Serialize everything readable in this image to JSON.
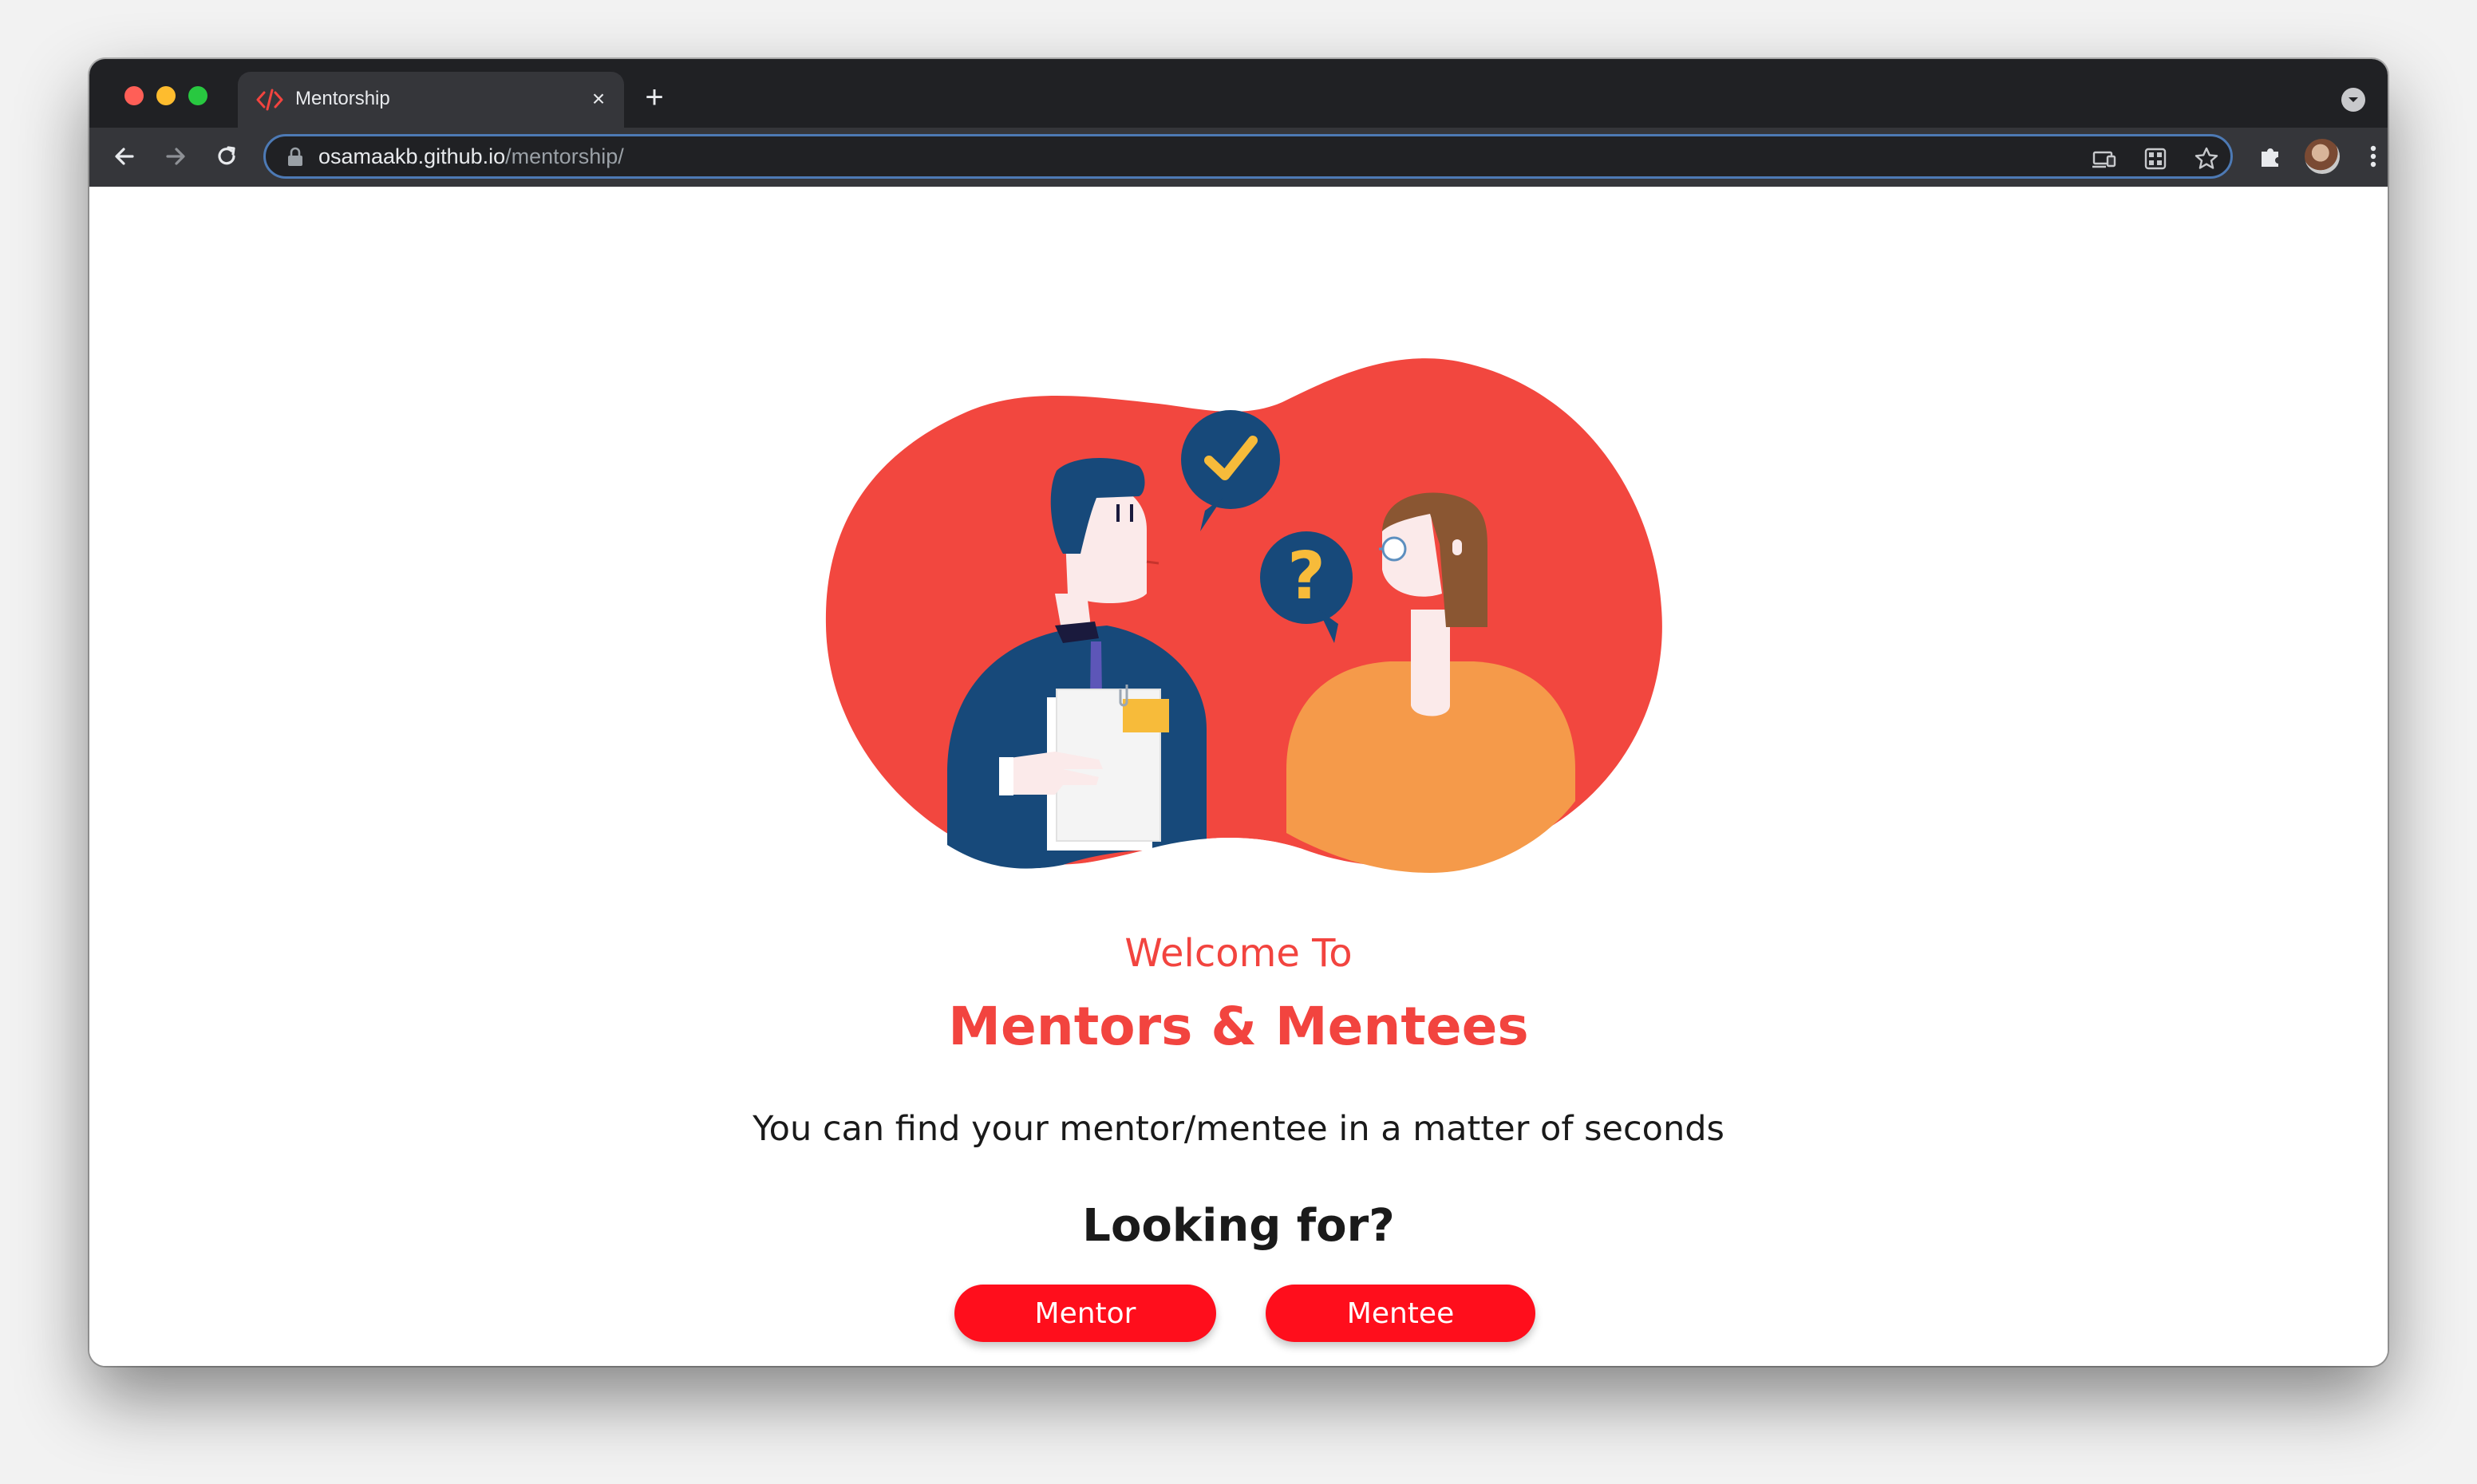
{
  "browser": {
    "tab": {
      "title": "Mentorship",
      "favicon": "code-icon",
      "close": "×"
    },
    "new_tab": "+",
    "url": {
      "host": "osamaakb.github.io",
      "path": "/mentorship/"
    }
  },
  "page": {
    "welcome": "Welcome To",
    "brand": "Mentors & Mentees",
    "tagline": "You can find your mentor/mentee in a matter of seconds",
    "looking_for": "Looking for?",
    "buttons": {
      "mentor": "Mentor",
      "mentee": "Mentee"
    }
  },
  "colors": {
    "accent": "#f2443f",
    "button": "#ff0e1c",
    "hero_blob": "#f2473f",
    "navy": "#17497a",
    "orange": "#f59a4a",
    "yellow": "#f7bb3a"
  }
}
